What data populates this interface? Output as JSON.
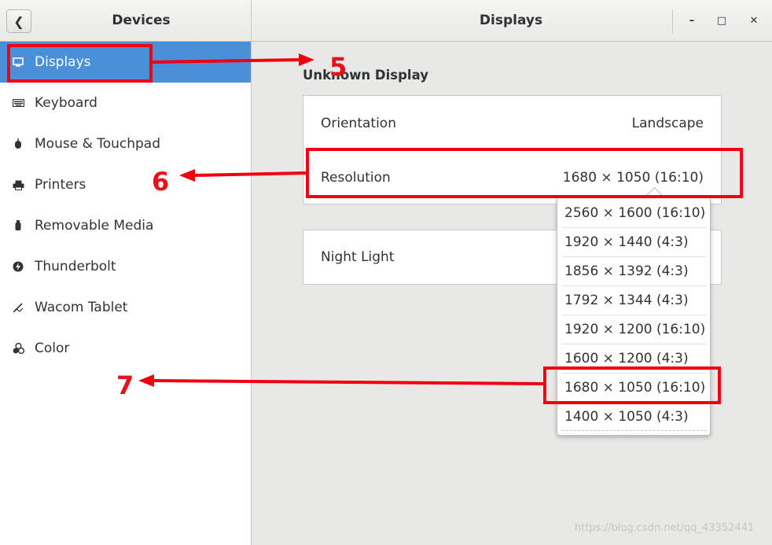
{
  "header": {
    "left_title": "Devices",
    "title": "Displays",
    "back_icon": "chevron-left-icon",
    "window_buttons": {
      "minimize": "–",
      "maximize": "□",
      "close": "✕"
    }
  },
  "sidebar": {
    "items": [
      {
        "label": "Displays",
        "icon": "display-icon",
        "active": true
      },
      {
        "label": "Keyboard",
        "icon": "keyboard-icon"
      },
      {
        "label": "Mouse & Touchpad",
        "icon": "mouse-icon"
      },
      {
        "label": "Printers",
        "icon": "printer-icon"
      },
      {
        "label": "Removable Media",
        "icon": "usb-icon"
      },
      {
        "label": "Thunderbolt",
        "icon": "thunderbolt-icon"
      },
      {
        "label": "Wacom Tablet",
        "icon": "tablet-icon"
      },
      {
        "label": "Color",
        "icon": "color-icon"
      }
    ]
  },
  "main": {
    "section_title": "Unknown Display",
    "orientation": {
      "label": "Orientation",
      "value": "Landscape"
    },
    "resolution": {
      "label": "Resolution",
      "value": "1680 × 1050 (16:10)"
    },
    "night_light": {
      "label": "Night Light"
    }
  },
  "resolution_options": [
    "2560 × 1600 (16:10)",
    "1920 × 1440 (4:3)",
    "1856 × 1392 (4:3)",
    "1792 × 1344 (4:3)",
    "1920 × 1200 (16:10)",
    "1600 × 1200 (4:3)",
    "1680 × 1050 (16:10)",
    "1400 × 1050 (4:3)"
  ],
  "annotations": {
    "step5": "5",
    "step6": "6",
    "step7": "7"
  },
  "watermark": "https://blog.csdn.net/qq_43352441",
  "colors": {
    "accent": "#4a90d9",
    "annotation": "#f0000e"
  }
}
